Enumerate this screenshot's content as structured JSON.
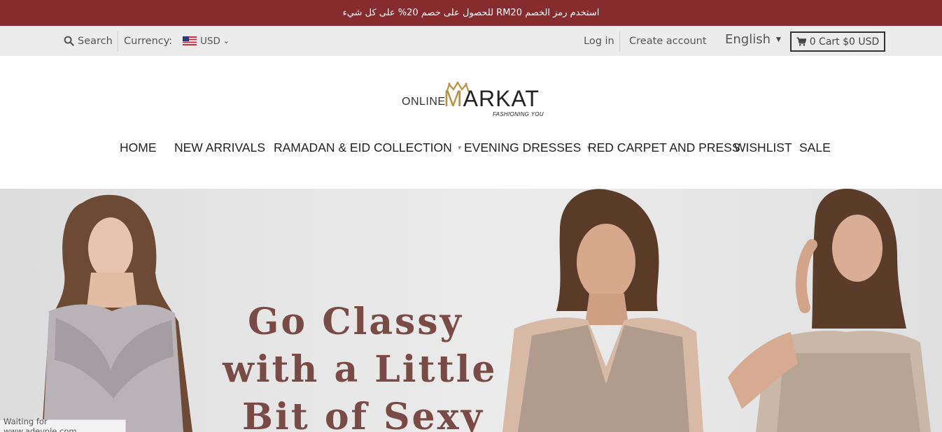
{
  "announcement": "استخدم رمز الخصم RM20 للحصول على خصم 20% على كل شيء",
  "topbar": {
    "search_label": "Search",
    "currency_label": "Currency:",
    "currency_value": "USD",
    "login": "Log in",
    "create_account": "Create account",
    "language": "English",
    "cart": "0 Cart $0 USD"
  },
  "logo": {
    "prefix": "ONLINE",
    "brand_first": "M",
    "brand_rest": "ARKAT",
    "tagline": "FASHIONING YOU"
  },
  "nav": {
    "home": "HOME",
    "new_arrivals": "NEW ARRIVALS",
    "ramadan": "RAMADAN & EID COLLECTION",
    "evening": "EVENING DRESSES",
    "red_carpet": "RED CARPET AND PRESS",
    "wishlist": "WISHLIST",
    "sale": "SALE"
  },
  "hero": {
    "line1": "Go  Classy",
    "line2": "with a Little",
    "line3": "Bit of Sexy"
  },
  "status_text": "Waiting for www.adevole.com...",
  "colors": {
    "announcement_bg": "#862b2e",
    "hero_text": "#7a4a46",
    "logo_gold": "#b8923f"
  }
}
